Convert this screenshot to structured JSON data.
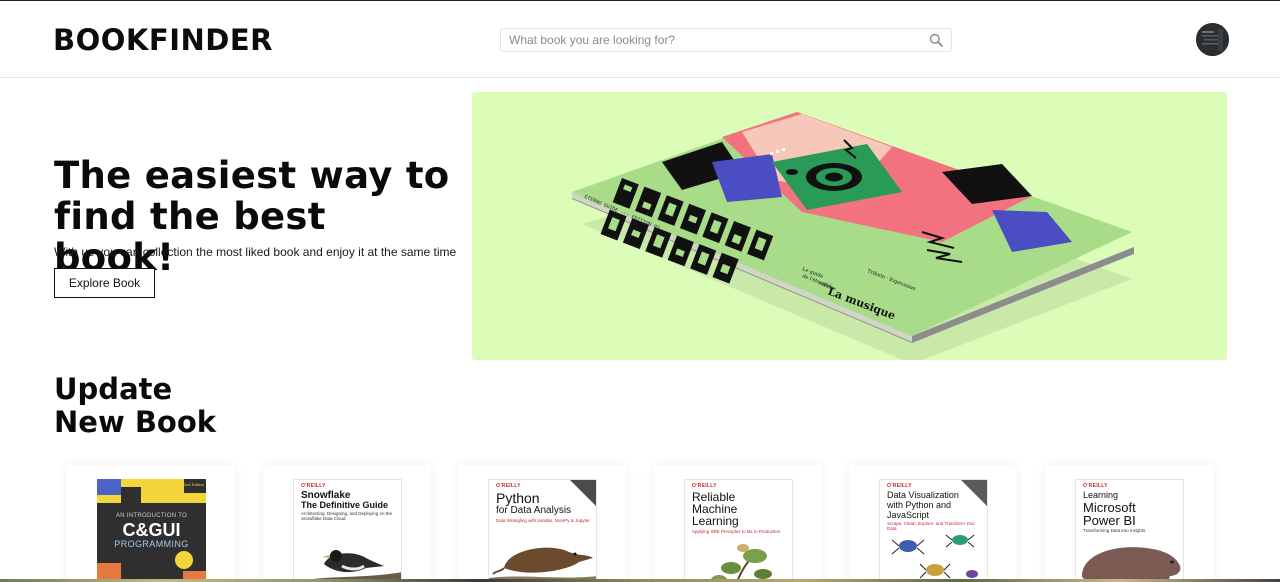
{
  "header": {
    "logo": "BOOKFINDER",
    "search_placeholder": "What book you are looking for?",
    "search_icon": "search-icon",
    "avatar": "avatar"
  },
  "hero": {
    "title": "The easiest way to find the best book!",
    "subtitle": "With us you can collection the most liked book and enjoy it at the same time",
    "button_label": "Explore Book",
    "image": {
      "background_color": "#dcfdb8",
      "cover_title": "ETERNO GUIDE TO THE",
      "spine_text": "ÉTERNO GUIDE",
      "cover_line_a": "La musique",
      "cover_line_b": "Guide to the"
    }
  },
  "section": {
    "title_line1": "Update",
    "title_line2": "New Book"
  },
  "books": [
    {
      "publisher": "",
      "title_a": "AN INTRODUCTION TO",
      "title_b": "C&GUI",
      "title_c": "PROGRAMMING",
      "subtitle": "",
      "badge": "2nd Edition"
    },
    {
      "publisher": "O'REILLY",
      "title_a": "Snowflake",
      "title_b": "The Definitive Guide",
      "subtitle": "Architecting, Designing, and Deploying on the Snowflake Data Cloud"
    },
    {
      "publisher": "O'REILLY",
      "title_a": "Python",
      "title_b": "for Data Analysis",
      "subtitle": "Data Wrangling with pandas, NumPy & Jupyter"
    },
    {
      "publisher": "O'REILLY",
      "title_a": "Reliable",
      "title_b": "Machine",
      "title_c": "Learning",
      "subtitle": "Applying SRE Principles to ML in Production"
    },
    {
      "publisher": "O'REILLY",
      "title_a": "Data Visualization",
      "title_b": "with Python and",
      "title_c": "JavaScript",
      "subtitle": "Scrape, Clean, Explore, and Transform Your Data"
    },
    {
      "publisher": "O'REILLY",
      "title_a": "Learning",
      "title_b": "Microsoft",
      "title_c": "Power BI",
      "subtitle": "Transforming Data into Insights"
    }
  ],
  "colors": {
    "hero_bg": "#dcfdb8",
    "text": "#0a0a0a",
    "oreilly_red": "#c4262e"
  }
}
